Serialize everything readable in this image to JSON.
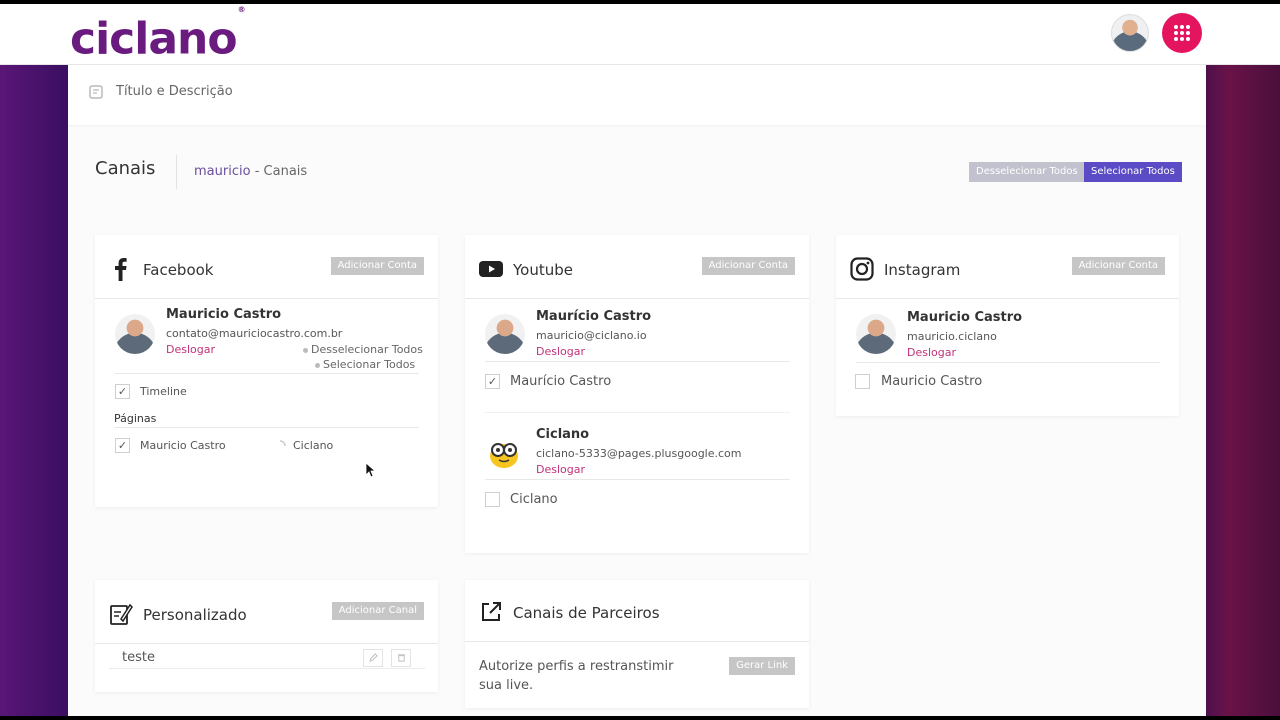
{
  "app": {
    "logo_text": "ciclano",
    "logo_mark": "®",
    "brand_color": "#6a1b7f",
    "accent_color": "#e5145f"
  },
  "title_bar": {
    "label": "Título e Descrição"
  },
  "header": {
    "title": "Canais",
    "breadcrumb_user": "mauricio",
    "breadcrumb_sep": "-",
    "breadcrumb_section": "Canais",
    "deselect_all": "Desselecionar Todos",
    "select_all": "Selecionar Todos"
  },
  "facebook": {
    "title": "Facebook",
    "add_label": "Adicionar Conta",
    "account": {
      "name": "Mauricio Castro",
      "email": "contato@mauriciocastro.com.br",
      "logout": "Deslogar",
      "deselect_all": "Desselecionar Todos",
      "select_all": "Selecionar Todos"
    },
    "timeline_label": "Timeline",
    "timeline_checked": true,
    "pages_heading": "Páginas",
    "pages": [
      {
        "label": "Mauricio Castro",
        "checked": true
      },
      {
        "label": "Ciclano",
        "checked": false
      }
    ]
  },
  "youtube": {
    "title": "Youtube",
    "add_label": "Adicionar Conta",
    "accounts": [
      {
        "name": "Maurício Castro",
        "email": "mauricio@ciclano.io",
        "logout": "Deslogar",
        "channel": "Maurício Castro",
        "checked": true
      },
      {
        "name": "Ciclano",
        "email": "ciclano-5333@pages.plusgoogle.com",
        "logout": "Deslogar",
        "channel": "Ciclano",
        "checked": false
      }
    ]
  },
  "instagram": {
    "title": "Instagram",
    "add_label": "Adicionar Conta",
    "account": {
      "name": "Mauricio Castro",
      "email": "mauricio.ciclano",
      "logout": "Deslogar",
      "channel": "Mauricio Castro",
      "checked": false
    }
  },
  "custom": {
    "title": "Personalizado",
    "add_label": "Adicionar Canal",
    "items": [
      {
        "label": "teste"
      }
    ]
  },
  "partners": {
    "title": "Canais de Parceiros",
    "description": "Autorize perfis a restranstimir sua live.",
    "button": "Gerar Link"
  }
}
